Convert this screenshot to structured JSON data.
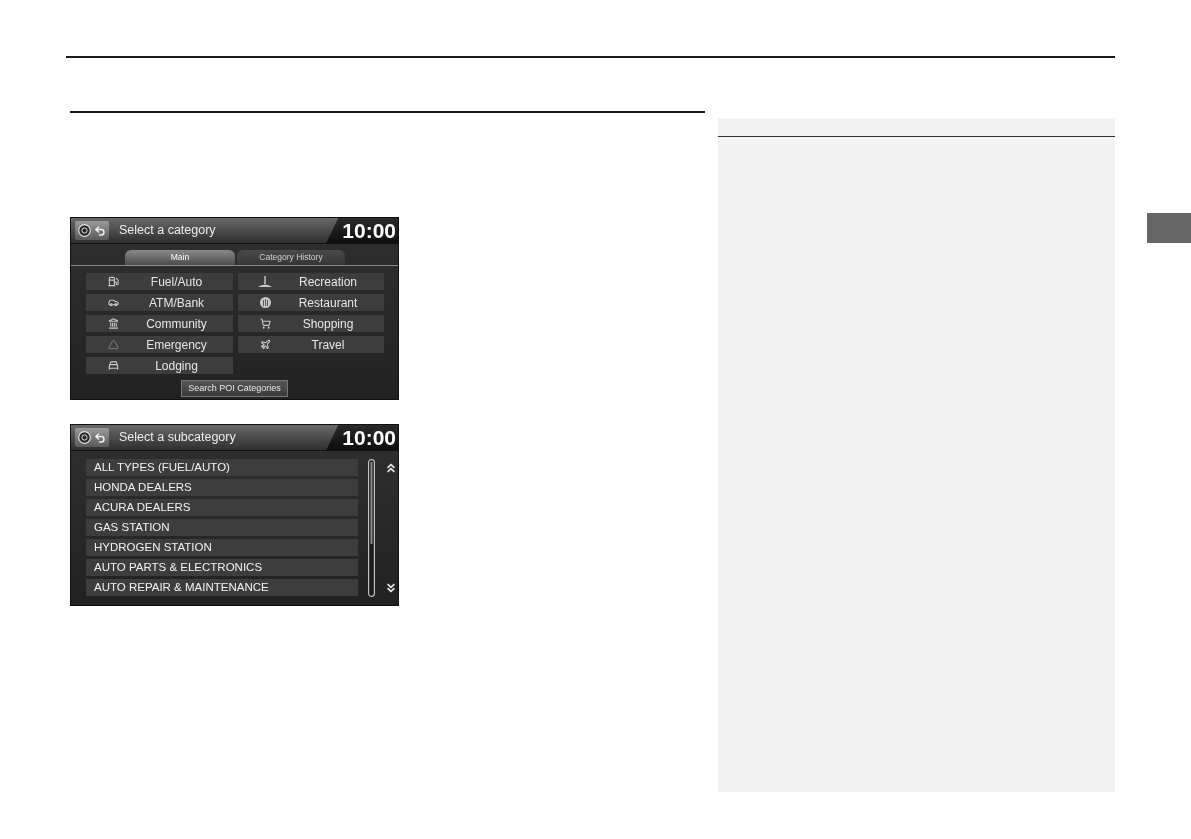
{
  "screens": [
    {
      "kind": "category",
      "title": "Select a category",
      "clock": "10:00",
      "tabs": [
        {
          "label": "Main",
          "selected": true
        },
        {
          "label": "Category History",
          "selected": false
        }
      ],
      "categories": [
        {
          "label": "Fuel/Auto"
        },
        {
          "label": "ATM/Bank"
        },
        {
          "label": "Community"
        },
        {
          "label": "Emergency"
        },
        {
          "label": "Lodging"
        },
        {
          "label": "Recreation"
        },
        {
          "label": "Restaurant"
        },
        {
          "label": "Shopping"
        },
        {
          "label": "Travel"
        }
      ],
      "button": "Search POI Categories"
    },
    {
      "kind": "subcategory",
      "title": "Select a subcategory",
      "clock": "10:00",
      "items": [
        "ALL TYPES (FUEL/AUTO)",
        "HONDA DEALERS",
        "ACURA DEALERS",
        "GAS STATION",
        "HYDROGEN STATION",
        "AUTO PARTS & ELECTRONICS",
        "AUTO REPAIR & MAINTENANCE"
      ]
    }
  ]
}
